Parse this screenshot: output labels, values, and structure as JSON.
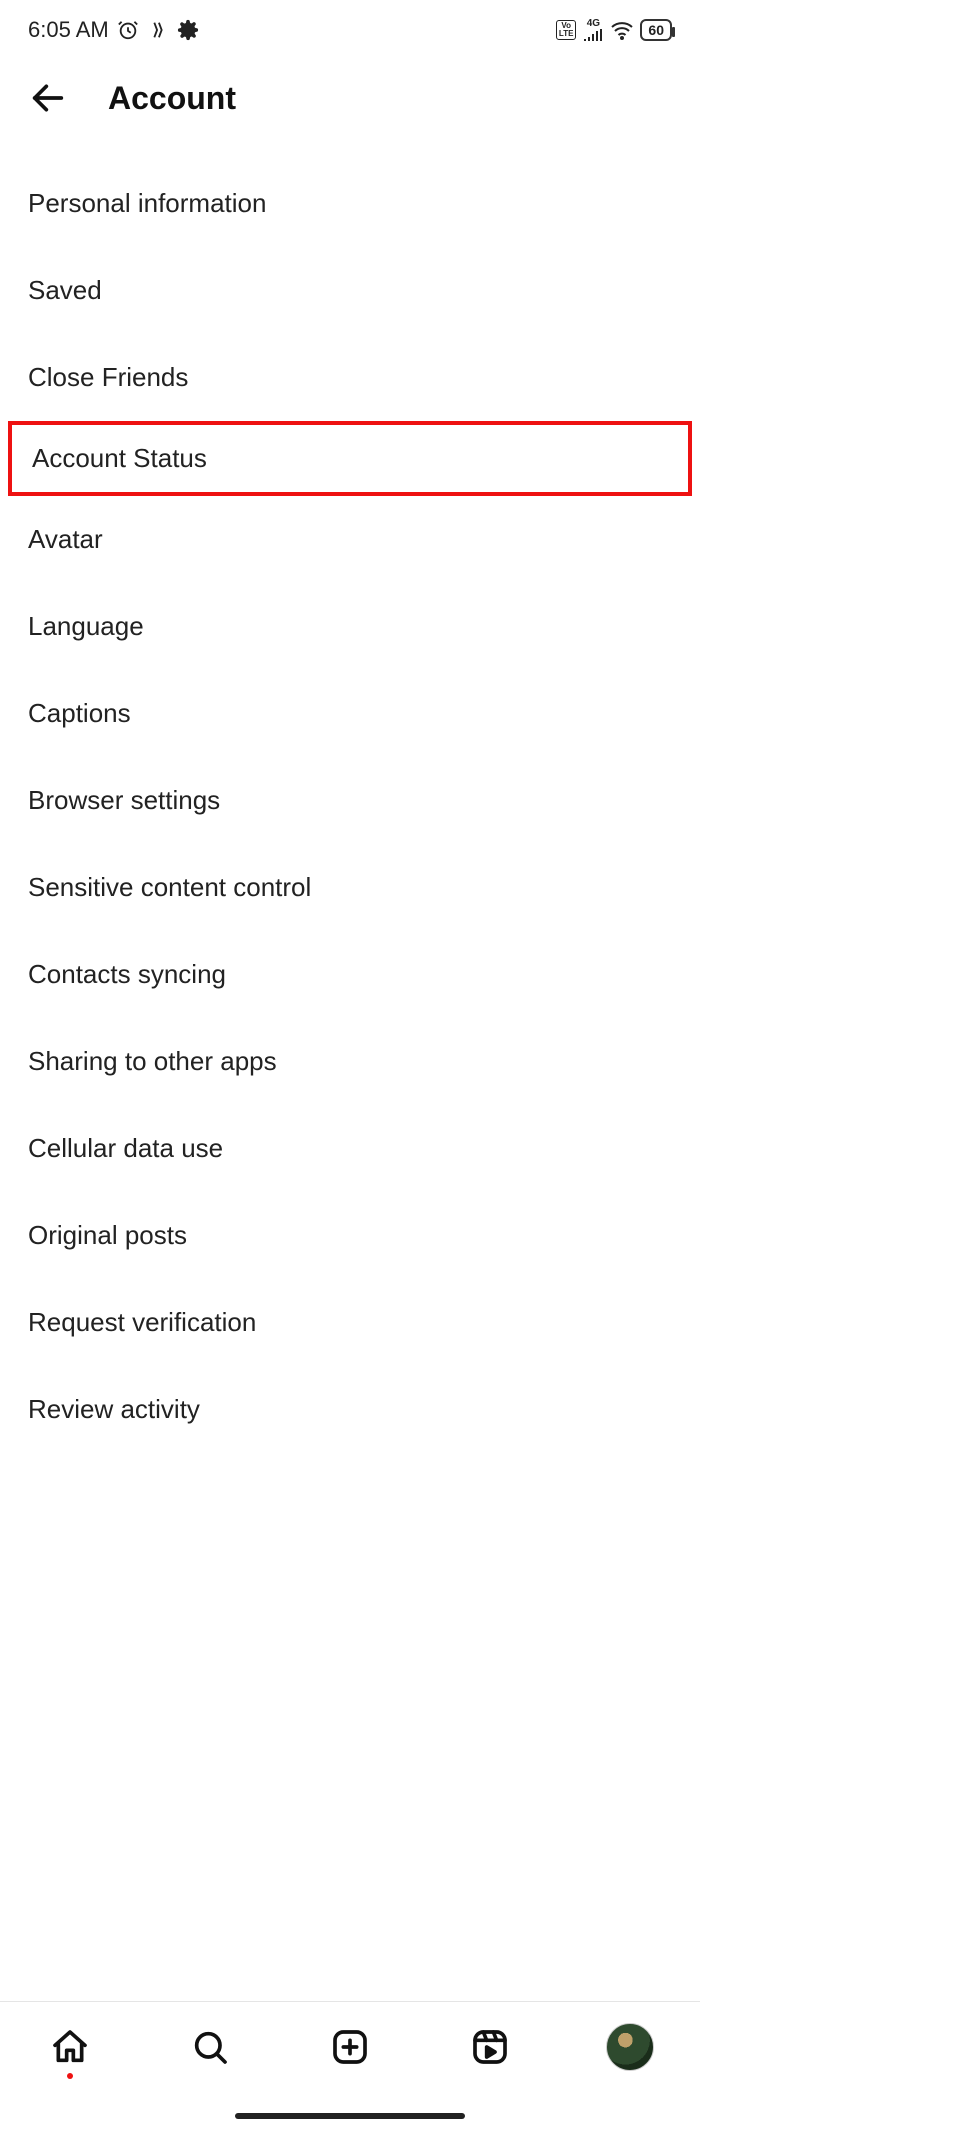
{
  "status_bar": {
    "time": "6:05 AM",
    "network_type": "4G",
    "volte": "Vo LTE",
    "battery": "60"
  },
  "header": {
    "title": "Account"
  },
  "menu": {
    "items": [
      {
        "label": "Personal information"
      },
      {
        "label": "Saved"
      },
      {
        "label": "Close Friends"
      },
      {
        "label": "Account Status"
      },
      {
        "label": "Avatar"
      },
      {
        "label": "Language"
      },
      {
        "label": "Captions"
      },
      {
        "label": "Browser settings"
      },
      {
        "label": "Sensitive content control"
      },
      {
        "label": "Contacts syncing"
      },
      {
        "label": "Sharing to other apps"
      },
      {
        "label": "Cellular data use"
      },
      {
        "label": "Original posts"
      },
      {
        "label": "Request verification"
      },
      {
        "label": "Review activity"
      }
    ],
    "highlighted_index": 3
  },
  "bottom_nav": {
    "home_has_notification": true
  }
}
